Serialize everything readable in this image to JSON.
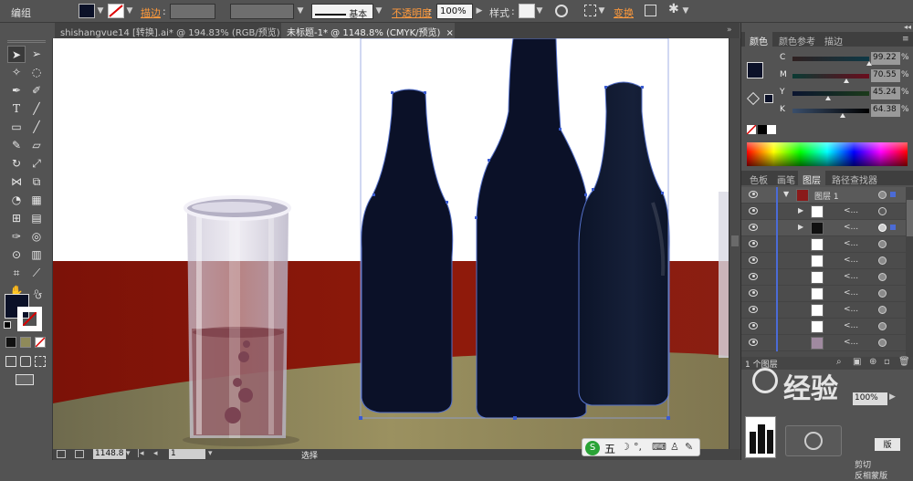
{
  "control_bar": {
    "doc_label": "编组",
    "stroke_label": "描边",
    "stroke_style": "基本",
    "opacity_label": "不透明度",
    "opacity_value": "100%",
    "style_label": "样式",
    "transform_label": "变换"
  },
  "tabs": [
    {
      "label": "shishangvue14 [转换].ai* @ 194.83% (RGB/预览)"
    },
    {
      "label": "未标题-1* @ 1148.8% (CMYK/预览)"
    }
  ],
  "color_panel": {
    "tabs": [
      "颜色",
      "颜色参考",
      "描边"
    ],
    "channels": [
      {
        "letter": "C",
        "value": "99.22",
        "pct": "%"
      },
      {
        "letter": "M",
        "value": "70.55",
        "pct": "%"
      },
      {
        "letter": "Y",
        "value": "45.24",
        "pct": "%"
      },
      {
        "letter": "K",
        "value": "64.38",
        "pct": "%"
      }
    ],
    "fill_color": "#0b1128"
  },
  "layers_panel": {
    "tabs": [
      "色板",
      "画笔",
      "图层",
      "路径查找器"
    ],
    "top_layer": "图层 1",
    "sublayer_label": "<...",
    "count_label": "1 个图层"
  },
  "status_bar": {
    "zoom": "1148.8",
    "page": "1",
    "tool": "选择"
  },
  "bottom_panel": {
    "opacity_value": "100%",
    "btn_label": "版",
    "clip_label": "剪切",
    "invert_label": "反相蒙版"
  },
  "ime": {
    "label": "五"
  },
  "watermark": {
    "text": "经验"
  }
}
